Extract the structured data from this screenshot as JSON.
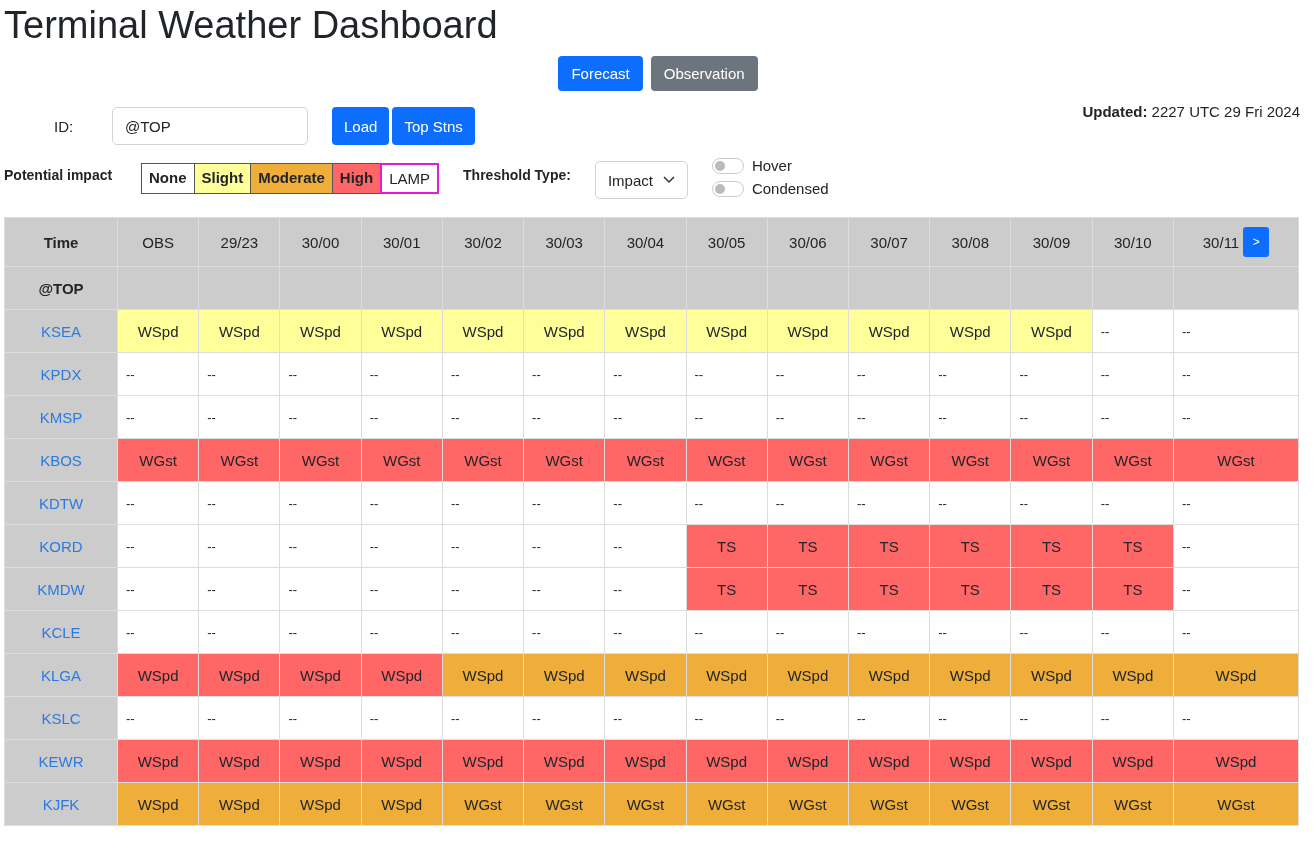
{
  "title": "Terminal Weather Dashboard",
  "modes": [
    {
      "label": "Forecast",
      "selected": true
    },
    {
      "label": "Observation",
      "selected": false
    }
  ],
  "id_field": {
    "label": "ID:",
    "value": "@TOP"
  },
  "buttons": [
    "Load",
    "Top Stns"
  ],
  "updated": {
    "label": "Updated:",
    "value": "2227 UTC 29 Fri 2024"
  },
  "legend": {
    "label": "Potential impact",
    "items": [
      {
        "label": "None",
        "kind": "fill",
        "color": "#ffffff"
      },
      {
        "label": "Slight",
        "kind": "fill",
        "color": "#ffff99"
      },
      {
        "label": "Moderate",
        "kind": "fill",
        "color": "#efad3a"
      },
      {
        "label": "High",
        "kind": "fill",
        "color": "#ff6666"
      },
      {
        "label": "LAMP",
        "kind": "outline",
        "color": "#e020d0"
      }
    ]
  },
  "threshold": {
    "label": "Threshold Type:",
    "value": "Impact"
  },
  "toggles": [
    {
      "label": "Hover",
      "on": false
    },
    {
      "label": "Condensed",
      "on": false
    }
  ],
  "table": {
    "corner": "Time",
    "columns": [
      "OBS",
      "29/23",
      "30/00",
      "30/01",
      "30/02",
      "30/03",
      "30/04",
      "30/05",
      "30/06",
      "30/07",
      "30/08",
      "30/09",
      "30/10",
      "30/11"
    ],
    "next_button": ">",
    "group": "@TOP",
    "rows": [
      {
        "station": "KSEA",
        "cells": [
          {
            "text": "WSpd",
            "color": "#ffff99"
          },
          {
            "text": "WSpd",
            "color": "#ffff99"
          },
          {
            "text": "WSpd",
            "color": "#ffff99"
          },
          {
            "text": "WSpd",
            "color": "#ffff99"
          },
          {
            "text": "WSpd",
            "color": "#ffff99"
          },
          {
            "text": "WSpd",
            "color": "#ffff99"
          },
          {
            "text": "WSpd",
            "color": "#ffff99"
          },
          {
            "text": "WSpd",
            "color": "#ffff99"
          },
          {
            "text": "WSpd",
            "color": "#ffff99"
          },
          {
            "text": "WSpd",
            "color": "#ffff99"
          },
          {
            "text": "WSpd",
            "color": "#ffff99"
          },
          {
            "text": "WSpd",
            "color": "#ffff99"
          },
          {
            "text": "--",
            "color": "#ffffff"
          },
          {
            "text": "--",
            "color": "#ffffff"
          }
        ]
      },
      {
        "station": "KPDX",
        "cells": [
          {
            "text": "--",
            "color": "#ffffff"
          },
          {
            "text": "--",
            "color": "#ffffff"
          },
          {
            "text": "--",
            "color": "#ffffff"
          },
          {
            "text": "--",
            "color": "#ffffff"
          },
          {
            "text": "--",
            "color": "#ffffff"
          },
          {
            "text": "--",
            "color": "#ffffff"
          },
          {
            "text": "--",
            "color": "#ffffff"
          },
          {
            "text": "--",
            "color": "#ffffff"
          },
          {
            "text": "--",
            "color": "#ffffff"
          },
          {
            "text": "--",
            "color": "#ffffff"
          },
          {
            "text": "--",
            "color": "#ffffff"
          },
          {
            "text": "--",
            "color": "#ffffff"
          },
          {
            "text": "--",
            "color": "#ffffff"
          },
          {
            "text": "--",
            "color": "#ffffff"
          }
        ]
      },
      {
        "station": "KMSP",
        "cells": [
          {
            "text": "--",
            "color": "#ffffff"
          },
          {
            "text": "--",
            "color": "#ffffff"
          },
          {
            "text": "--",
            "color": "#ffffff"
          },
          {
            "text": "--",
            "color": "#ffffff"
          },
          {
            "text": "--",
            "color": "#ffffff"
          },
          {
            "text": "--",
            "color": "#ffffff"
          },
          {
            "text": "--",
            "color": "#ffffff"
          },
          {
            "text": "--",
            "color": "#ffffff"
          },
          {
            "text": "--",
            "color": "#ffffff"
          },
          {
            "text": "--",
            "color": "#ffffff"
          },
          {
            "text": "--",
            "color": "#ffffff"
          },
          {
            "text": "--",
            "color": "#ffffff"
          },
          {
            "text": "--",
            "color": "#ffffff"
          },
          {
            "text": "--",
            "color": "#ffffff"
          }
        ]
      },
      {
        "station": "KBOS",
        "cells": [
          {
            "text": "WGst",
            "color": "#ff6666"
          },
          {
            "text": "WGst",
            "color": "#ff6666"
          },
          {
            "text": "WGst",
            "color": "#ff6666"
          },
          {
            "text": "WGst",
            "color": "#ff6666"
          },
          {
            "text": "WGst",
            "color": "#ff6666"
          },
          {
            "text": "WGst",
            "color": "#ff6666"
          },
          {
            "text": "WGst",
            "color": "#ff6666"
          },
          {
            "text": "WGst",
            "color": "#ff6666"
          },
          {
            "text": "WGst",
            "color": "#ff6666"
          },
          {
            "text": "WGst",
            "color": "#ff6666"
          },
          {
            "text": "WGst",
            "color": "#ff6666"
          },
          {
            "text": "WGst",
            "color": "#ff6666"
          },
          {
            "text": "WGst",
            "color": "#ff6666"
          },
          {
            "text": "WGst",
            "color": "#ff6666"
          }
        ]
      },
      {
        "station": "KDTW",
        "cells": [
          {
            "text": "--",
            "color": "#ffffff"
          },
          {
            "text": "--",
            "color": "#ffffff"
          },
          {
            "text": "--",
            "color": "#ffffff"
          },
          {
            "text": "--",
            "color": "#ffffff"
          },
          {
            "text": "--",
            "color": "#ffffff"
          },
          {
            "text": "--",
            "color": "#ffffff"
          },
          {
            "text": "--",
            "color": "#ffffff"
          },
          {
            "text": "--",
            "color": "#ffffff"
          },
          {
            "text": "--",
            "color": "#ffffff"
          },
          {
            "text": "--",
            "color": "#ffffff"
          },
          {
            "text": "--",
            "color": "#ffffff"
          },
          {
            "text": "--",
            "color": "#ffffff"
          },
          {
            "text": "--",
            "color": "#ffffff"
          },
          {
            "text": "--",
            "color": "#ffffff"
          }
        ]
      },
      {
        "station": "KORD",
        "cells": [
          {
            "text": "--",
            "color": "#ffffff"
          },
          {
            "text": "--",
            "color": "#ffffff"
          },
          {
            "text": "--",
            "color": "#ffffff"
          },
          {
            "text": "--",
            "color": "#ffffff"
          },
          {
            "text": "--",
            "color": "#ffffff"
          },
          {
            "text": "--",
            "color": "#ffffff"
          },
          {
            "text": "--",
            "color": "#ffffff"
          },
          {
            "text": "TS",
            "color": "#ff6666"
          },
          {
            "text": "TS",
            "color": "#ff6666"
          },
          {
            "text": "TS",
            "color": "#ff6666"
          },
          {
            "text": "TS",
            "color": "#ff6666"
          },
          {
            "text": "TS",
            "color": "#ff6666"
          },
          {
            "text": "TS",
            "color": "#ff6666"
          },
          {
            "text": "--",
            "color": "#ffffff"
          }
        ]
      },
      {
        "station": "KMDW",
        "cells": [
          {
            "text": "--",
            "color": "#ffffff"
          },
          {
            "text": "--",
            "color": "#ffffff"
          },
          {
            "text": "--",
            "color": "#ffffff"
          },
          {
            "text": "--",
            "color": "#ffffff"
          },
          {
            "text": "--",
            "color": "#ffffff"
          },
          {
            "text": "--",
            "color": "#ffffff"
          },
          {
            "text": "--",
            "color": "#ffffff"
          },
          {
            "text": "TS",
            "color": "#ff6666"
          },
          {
            "text": "TS",
            "color": "#ff6666"
          },
          {
            "text": "TS",
            "color": "#ff6666"
          },
          {
            "text": "TS",
            "color": "#ff6666"
          },
          {
            "text": "TS",
            "color": "#ff6666"
          },
          {
            "text": "TS",
            "color": "#ff6666"
          },
          {
            "text": "--",
            "color": "#ffffff"
          }
        ]
      },
      {
        "station": "KCLE",
        "cells": [
          {
            "text": "--",
            "color": "#ffffff"
          },
          {
            "text": "--",
            "color": "#ffffff"
          },
          {
            "text": "--",
            "color": "#ffffff"
          },
          {
            "text": "--",
            "color": "#ffffff"
          },
          {
            "text": "--",
            "color": "#ffffff"
          },
          {
            "text": "--",
            "color": "#ffffff"
          },
          {
            "text": "--",
            "color": "#ffffff"
          },
          {
            "text": "--",
            "color": "#ffffff"
          },
          {
            "text": "--",
            "color": "#ffffff"
          },
          {
            "text": "--",
            "color": "#ffffff"
          },
          {
            "text": "--",
            "color": "#ffffff"
          },
          {
            "text": "--",
            "color": "#ffffff"
          },
          {
            "text": "--",
            "color": "#ffffff"
          },
          {
            "text": "--",
            "color": "#ffffff"
          }
        ]
      },
      {
        "station": "KLGA",
        "cells": [
          {
            "text": "WSpd",
            "color": "#ff6666"
          },
          {
            "text": "WSpd",
            "color": "#ff6666"
          },
          {
            "text": "WSpd",
            "color": "#ff6666"
          },
          {
            "text": "WSpd",
            "color": "#ff6666"
          },
          {
            "text": "WSpd",
            "color": "#efad3a"
          },
          {
            "text": "WSpd",
            "color": "#efad3a"
          },
          {
            "text": "WSpd",
            "color": "#efad3a"
          },
          {
            "text": "WSpd",
            "color": "#efad3a"
          },
          {
            "text": "WSpd",
            "color": "#efad3a"
          },
          {
            "text": "WSpd",
            "color": "#efad3a"
          },
          {
            "text": "WSpd",
            "color": "#efad3a"
          },
          {
            "text": "WSpd",
            "color": "#efad3a"
          },
          {
            "text": "WSpd",
            "color": "#efad3a"
          },
          {
            "text": "WSpd",
            "color": "#efad3a"
          }
        ]
      },
      {
        "station": "KSLC",
        "cells": [
          {
            "text": "--",
            "color": "#ffffff"
          },
          {
            "text": "--",
            "color": "#ffffff"
          },
          {
            "text": "--",
            "color": "#ffffff"
          },
          {
            "text": "--",
            "color": "#ffffff"
          },
          {
            "text": "--",
            "color": "#ffffff"
          },
          {
            "text": "--",
            "color": "#ffffff"
          },
          {
            "text": "--",
            "color": "#ffffff"
          },
          {
            "text": "--",
            "color": "#ffffff"
          },
          {
            "text": "--",
            "color": "#ffffff"
          },
          {
            "text": "--",
            "color": "#ffffff"
          },
          {
            "text": "--",
            "color": "#ffffff"
          },
          {
            "text": "--",
            "color": "#ffffff"
          },
          {
            "text": "--",
            "color": "#ffffff"
          },
          {
            "text": "--",
            "color": "#ffffff"
          }
        ]
      },
      {
        "station": "KEWR",
        "cells": [
          {
            "text": "WSpd",
            "color": "#ff6666"
          },
          {
            "text": "WSpd",
            "color": "#ff6666"
          },
          {
            "text": "WSpd",
            "color": "#ff6666"
          },
          {
            "text": "WSpd",
            "color": "#ff6666"
          },
          {
            "text": "WSpd",
            "color": "#ff6666"
          },
          {
            "text": "WSpd",
            "color": "#ff6666"
          },
          {
            "text": "WSpd",
            "color": "#ff6666"
          },
          {
            "text": "WSpd",
            "color": "#ff6666"
          },
          {
            "text": "WSpd",
            "color": "#ff6666"
          },
          {
            "text": "WSpd",
            "color": "#ff6666"
          },
          {
            "text": "WSpd",
            "color": "#ff6666"
          },
          {
            "text": "WSpd",
            "color": "#ff6666"
          },
          {
            "text": "WSpd",
            "color": "#ff6666"
          },
          {
            "text": "WSpd",
            "color": "#ff6666"
          }
        ]
      },
      {
        "station": "KJFK",
        "cells": [
          {
            "text": "WSpd",
            "color": "#efad3a"
          },
          {
            "text": "WSpd",
            "color": "#efad3a"
          },
          {
            "text": "WSpd",
            "color": "#efad3a"
          },
          {
            "text": "WSpd",
            "color": "#efad3a"
          },
          {
            "text": "WGst",
            "color": "#efad3a"
          },
          {
            "text": "WGst",
            "color": "#efad3a"
          },
          {
            "text": "WGst",
            "color": "#efad3a"
          },
          {
            "text": "WGst",
            "color": "#efad3a"
          },
          {
            "text": "WGst",
            "color": "#efad3a"
          },
          {
            "text": "WGst",
            "color": "#efad3a"
          },
          {
            "text": "WGst",
            "color": "#efad3a"
          },
          {
            "text": "WGst",
            "color": "#efad3a"
          },
          {
            "text": "WGst",
            "color": "#efad3a"
          },
          {
            "text": "WGst",
            "color": "#efad3a"
          }
        ]
      }
    ]
  }
}
